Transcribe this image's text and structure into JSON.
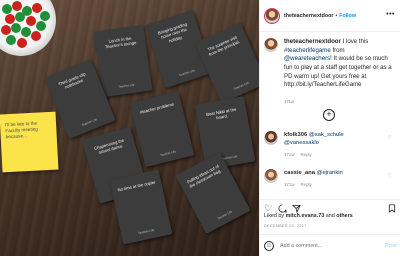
{
  "photo": {
    "cards": [
      "Lunch in the Teacher's lounge",
      "Bringing grading home over the holiday.",
      "The surprise visit from the principal.",
      "Third grade clip notebooks",
      "#teacher problems",
      "Beat Nikki at the board.",
      "Chaperoning the school dance",
      "Pulling ideas out of the classroom bag.",
      "No time at the copier"
    ],
    "card_logo": "Teacher Life",
    "sticky_note": "I'll be late to the Faculty meeting because..."
  },
  "header": {
    "username": "theteachernextdoor",
    "separator": "•",
    "follow_label": "Follow",
    "more_label": "•••"
  },
  "caption": {
    "username": "theteachernextdoor",
    "text_1": " I love this ",
    "hashtag": "#teacherlifegame",
    "text_2": " from ",
    "mention": "@weareteachers",
    "text_3": "! It would be so much fun to play at a staff get together or as a PD warm up! Get yours free at ",
    "url": "http://bit.ly/TeacherLifeGame",
    "time": "171w"
  },
  "load_more_label": "+",
  "comments": [
    {
      "username": "kfolk306",
      "mention_1": "@sak_schule",
      "mention_2": "@vanessaklo",
      "time": "171w",
      "reply": "Reply"
    },
    {
      "username": "cassie_ana",
      "mention_1": "@ejrankin",
      "time": "171w",
      "reply": "Reply"
    }
  ],
  "actions": {
    "like_icon": "heart-icon",
    "comment_icon": "comment-icon",
    "share_icon": "share-icon",
    "save_icon": "bookmark-icon"
  },
  "likes": {
    "prefix": "Liked by ",
    "user": "mitch.evans.73",
    "middle": " and ",
    "others": "others"
  },
  "date": "DECEMBER 20, 2017",
  "add_comment": {
    "placeholder": "Add a comment...",
    "post_label": "Post"
  }
}
